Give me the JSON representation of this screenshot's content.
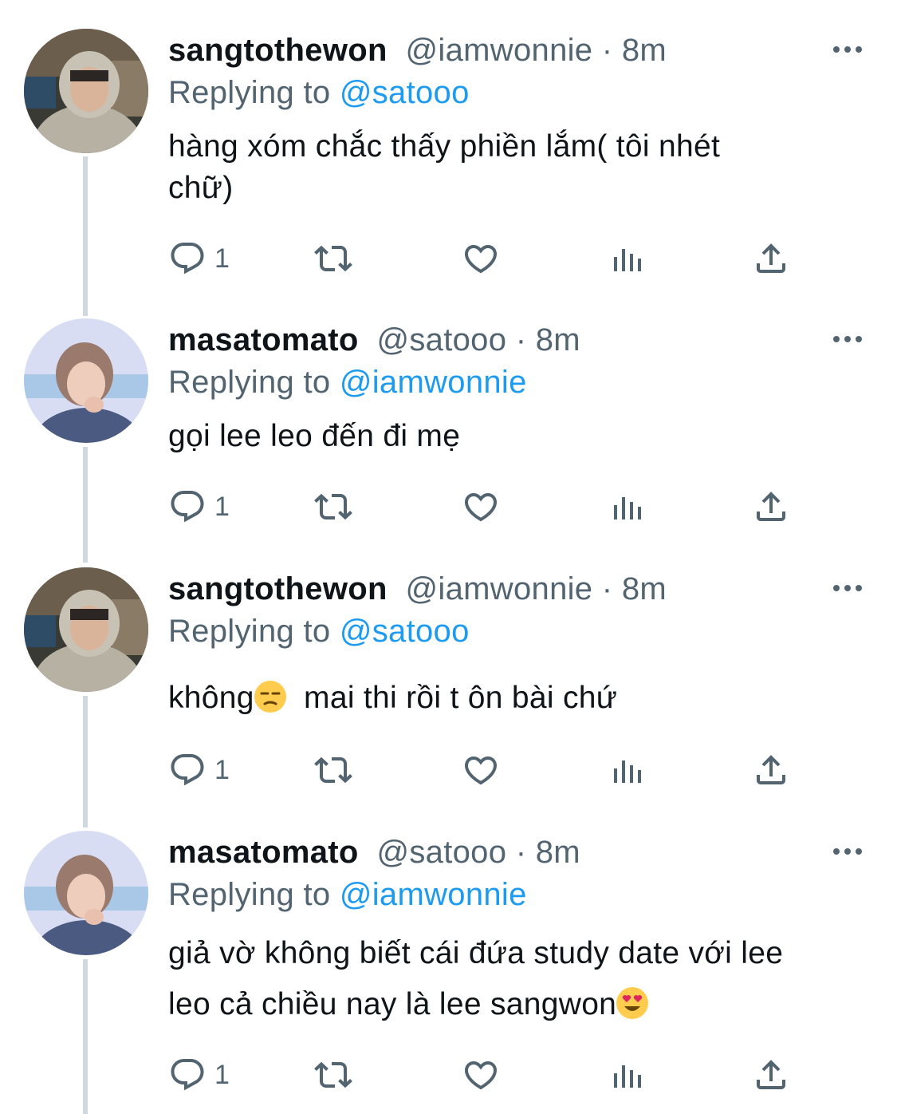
{
  "tweets": [
    {
      "display_name": "sangtothewon",
      "handle": "@iamwonnie",
      "time": "· 8m",
      "replying_prefix": "Replying to",
      "replying_to": "@satooo",
      "text_lines": [
        "hàng xóm chắc thấy phiền lắm( tôi nhét",
        "chữ)"
      ],
      "reply_count": "1",
      "avatar": "hooded-person-avatar"
    },
    {
      "display_name": "masatomato",
      "handle": "@satooo",
      "time": "· 8m",
      "replying_prefix": "Replying to",
      "replying_to": "@iamwonnie",
      "text_lines": [
        "gọi lee leo đến đi mẹ"
      ],
      "reply_count": "1",
      "avatar": "smiling-person-avatar"
    },
    {
      "display_name": "sangtothewon",
      "handle": "@iamwonnie",
      "time": "· 8m",
      "replying_prefix": "Replying to",
      "replying_to": "@satooo",
      "text_before_emoji": "không",
      "text_after_emoji": "  mai thi rồi t ôn bài chứ",
      "emoji": "unamused-face-emoji",
      "reply_count": "1",
      "avatar": "hooded-person-avatar"
    },
    {
      "display_name": "masatomato",
      "handle": "@satooo",
      "time": "· 8m",
      "replying_prefix": "Replying to",
      "replying_to": "@iamwonnie",
      "text_lines": [
        "giả vờ không biết cái đứa study date với lee"
      ],
      "text_line2_before_emoji": "leo cả chiều nay là lee sangwon",
      "emoji": "heart-eyes-emoji",
      "reply_count": "1",
      "avatar": "smiling-person-avatar"
    }
  ],
  "icons": {
    "reply": "reply-icon",
    "retweet": "retweet-icon",
    "like": "heart-icon",
    "views": "views-icon",
    "share": "share-icon",
    "more": "more-options-icon"
  },
  "colors": {
    "mention": "#1d9bf0",
    "secondary_text": "#536471",
    "primary_text": "#0f1419",
    "thread_line": "#cfd9de"
  }
}
